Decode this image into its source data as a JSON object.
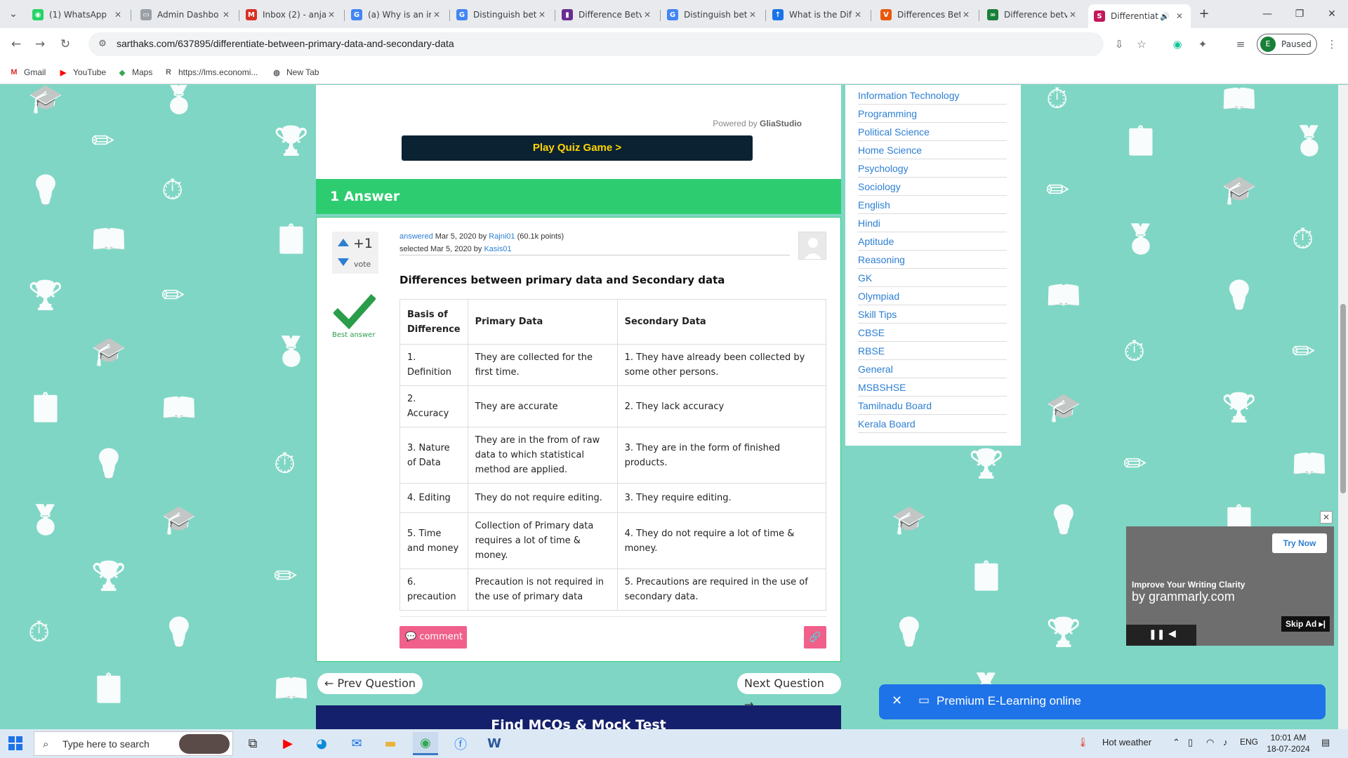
{
  "browser": {
    "tabs": [
      {
        "label": "(1) WhatsApp",
        "icon": "whatsapp-icon",
        "color": "#25d366",
        "glyph": "◉"
      },
      {
        "label": "Admin Dashbo",
        "icon": "doc-icon",
        "color": "#9aa0a6",
        "glyph": "▭"
      },
      {
        "label": "Inbox (2) - anja",
        "icon": "gmail-icon",
        "color": "#d93025",
        "glyph": "M"
      },
      {
        "label": "(a) Why is an ir",
        "icon": "google-icon",
        "color": "#4285f4",
        "glyph": "G"
      },
      {
        "label": "Distinguish bet",
        "icon": "google-icon",
        "color": "#4285f4",
        "glyph": "G"
      },
      {
        "label": "Difference Betv",
        "icon": "bookmark-icon",
        "color": "#6b2c91",
        "glyph": "▮"
      },
      {
        "label": "Distinguish bet",
        "icon": "google-icon",
        "color": "#4285f4",
        "glyph": "G"
      },
      {
        "label": "What is the Dif",
        "icon": "compass-icon",
        "color": "#1a73e8",
        "glyph": "↑"
      },
      {
        "label": "Differences Bet",
        "icon": "v-icon",
        "color": "#e8590c",
        "glyph": "V"
      },
      {
        "label": "Difference betv",
        "icon": "link-icon",
        "color": "#188038",
        "glyph": "∞"
      },
      {
        "label": "Differentiat",
        "icon": "sarthaks-icon",
        "color": "#c2185b",
        "glyph": "S"
      }
    ],
    "new_tab": "+",
    "url": "sarthaks.com/637895/differentiate-between-primary-data-and-secondary-data",
    "profile_initial": "E",
    "profile_status": "Paused",
    "bookmarks": [
      {
        "label": "Gmail",
        "color": "#d93025",
        "glyph": "M"
      },
      {
        "label": "YouTube",
        "color": "#ff0000",
        "glyph": "▶"
      },
      {
        "label": "Maps",
        "color": "#34a853",
        "glyph": "◆"
      },
      {
        "label": "https://lms.economi...",
        "color": "#5f6368",
        "glyph": "R"
      },
      {
        "label": "New Tab",
        "color": "#5f6368",
        "glyph": "◍"
      }
    ]
  },
  "quiz": {
    "powered_by": "Powered by",
    "powered_brand": "GliaStudio",
    "play_label": "Play Quiz Game >"
  },
  "answer_header": "1 Answer",
  "answer": {
    "votes": "+1",
    "vote_label": "vote",
    "best_label": "Best answer",
    "answered_word": "answered",
    "answered_date": "Mar 5, 2020 by",
    "answerer": "Rajni01",
    "points": "(60.1k points)",
    "selected_text": "selected Mar 5, 2020 by",
    "selector": "Kasis01",
    "title": "Differences between primary data and Secondary data",
    "table": {
      "headers": [
        "Basis of Difference",
        "Primary Data",
        "Secondary Data"
      ],
      "rows": [
        [
          "1. Definition",
          "They are collected for the first time.",
          "1. They have already been collected by some other persons."
        ],
        [
          "2. Accuracy",
          "They are accurate",
          "2. They lack accuracy"
        ],
        [
          "3. Nature of Data",
          "They are in the from of raw data to which statistical method are applied.",
          "3. They are in the form of finished products."
        ],
        [
          "4. Editing",
          "They do not require editing.",
          "3. They require editing."
        ],
        [
          "5. Time and money",
          "Collection of Primary data requires a lot of time & money.",
          "4. They do not require a lot of time & money."
        ],
        [
          "6. precaution",
          "Precaution is not required in the use of primary data",
          "5. Precautions are required in the use of secondary data."
        ]
      ]
    },
    "comment_label": "comment"
  },
  "pager": {
    "prev": "← Prev Question",
    "next": "Next Question →"
  },
  "mcq_banner": "Find MCQs & Mock Test",
  "sidebar": [
    "Information Technology",
    "Programming",
    "Political Science",
    "Home Science",
    "Psychology",
    "Sociology",
    "English",
    "Hindi",
    "Aptitude",
    "Reasoning",
    "GK",
    "Olympiad",
    "Skill Tips",
    "CBSE",
    "RBSE",
    "General",
    "MSBSHSE",
    "Tamilnadu Board",
    "Kerala Board"
  ],
  "ad": {
    "try_now": "Try Now",
    "line1": "Improve Your Writing Clarity",
    "line2": "by grammarly.com",
    "skip": "Skip Ad ▸|"
  },
  "promo": "Premium E-Learning online",
  "taskbar": {
    "search_placeholder": "Type here to search",
    "weather": "Hot weather",
    "language": "ENG",
    "time": "10:01 AM",
    "date": "18-07-2024"
  },
  "colors": {
    "page_bg": "#7fd6c4",
    "answer_green": "#2ecc71",
    "link_blue": "#2d7fd3",
    "pink_button": "#f0608a",
    "quiz_yellow": "#ffd400",
    "mcq_navy": "#14206b",
    "promo_blue": "#1e73e8"
  }
}
